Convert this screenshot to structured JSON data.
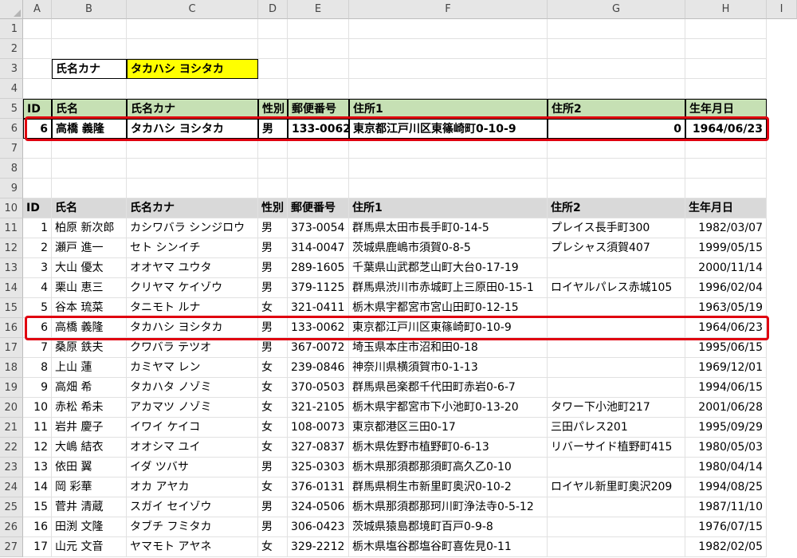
{
  "columns": [
    "A",
    "B",
    "C",
    "D",
    "E",
    "F",
    "G",
    "H",
    "I"
  ],
  "row_numbers": [
    "1",
    "2",
    "3",
    "4",
    "5",
    "6",
    "7",
    "8",
    "9",
    "10",
    "11",
    "12",
    "13",
    "14",
    "15",
    "16",
    "17",
    "18",
    "19",
    "20",
    "21",
    "22",
    "23",
    "24",
    "25",
    "26",
    "27"
  ],
  "search": {
    "label": "氏名カナ",
    "value": "タカハシ ヨシタカ"
  },
  "result_table": {
    "headers": [
      "ID",
      "氏名",
      "氏名カナ",
      "性別",
      "郵便番号",
      "住所1",
      "住所2",
      "生年月日"
    ],
    "row": [
      "6",
      "高橋 義隆",
      "タカハシ ヨシタカ",
      "男",
      "133-0062",
      "東京都江戸川区東篠崎町0-10-9",
      "0",
      "1964/06/23"
    ]
  },
  "data_table": {
    "headers": [
      "ID",
      "氏名",
      "氏名カナ",
      "性別",
      "郵便番号",
      "住所1",
      "住所2",
      "生年月日"
    ],
    "rows": [
      [
        "1",
        "柏原 新次郎",
        "カシワバラ シンジロウ",
        "男",
        "373-0054",
        "群馬県太田市長手町0-14-5",
        "プレイス長手町300",
        "1982/03/07"
      ],
      [
        "2",
        "瀬戸 進一",
        "セト シンイチ",
        "男",
        "314-0047",
        "茨城県鹿嶋市須賀0-8-5",
        "プレシャス須賀407",
        "1999/05/15"
      ],
      [
        "3",
        "大山 優太",
        "オオヤマ ユウタ",
        "男",
        "289-1605",
        "千葉県山武郡芝山町大台0-17-19",
        "",
        "2000/11/14"
      ],
      [
        "4",
        "栗山 恵三",
        "クリヤマ ケイゾウ",
        "男",
        "379-1125",
        "群馬県渋川市赤城町上三原田0-15-1",
        "ロイヤルパレス赤城105",
        "1996/02/04"
      ],
      [
        "5",
        "谷本 琉菜",
        "タニモト ルナ",
        "女",
        "321-0411",
        "栃木県宇都宮市宮山田町0-12-15",
        "",
        "1963/05/19"
      ],
      [
        "6",
        "高橋 義隆",
        "タカハシ ヨシタカ",
        "男",
        "133-0062",
        "東京都江戸川区東篠崎町0-10-9",
        "",
        "1964/06/23"
      ],
      [
        "7",
        "桑原 鉄夫",
        "クワバラ テツオ",
        "男",
        "367-0072",
        "埼玉県本庄市沼和田0-18",
        "",
        "1995/06/15"
      ],
      [
        "8",
        "上山 蓮",
        "カミヤマ レン",
        "女",
        "239-0846",
        "神奈川県横須賀市0-1-13",
        "",
        "1969/12/01"
      ],
      [
        "9",
        "高畑 希",
        "タカハタ ノゾミ",
        "女",
        "370-0503",
        "群馬県邑楽郡千代田町赤岩0-6-7",
        "",
        "1994/06/15"
      ],
      [
        "10",
        "赤松 希未",
        "アカマツ ノゾミ",
        "女",
        "321-2105",
        "栃木県宇都宮市下小池町0-13-20",
        "タワー下小池町217",
        "2001/06/28"
      ],
      [
        "11",
        "岩井 慶子",
        "イワイ ケイコ",
        "女",
        "108-0073",
        "東京都港区三田0-17",
        "三田パレス201",
        "1995/09/29"
      ],
      [
        "12",
        "大嶋 結衣",
        "オオシマ ユイ",
        "女",
        "327-0837",
        "栃木県佐野市植野町0-6-13",
        "リバーサイド植野町415",
        "1980/05/03"
      ],
      [
        "13",
        "依田 翼",
        "イダ ツバサ",
        "男",
        "325-0303",
        "栃木県那須郡那須町高久乙0-10",
        "",
        "1980/04/14"
      ],
      [
        "14",
        "岡 彩華",
        "オカ アヤカ",
        "女",
        "376-0131",
        "群馬県桐生市新里町奥沢0-10-2",
        "ロイヤル新里町奥沢209",
        "1994/08/25"
      ],
      [
        "15",
        "菅井 清蔵",
        "スガイ セイゾウ",
        "男",
        "324-0506",
        "栃木県那須郡那珂川町浄法寺0-5-12",
        "",
        "1987/11/10"
      ],
      [
        "16",
        "田渕 文隆",
        "タブチ フミタカ",
        "男",
        "306-0423",
        "茨城県猿島郡境町百戸0-9-8",
        "",
        "1976/07/15"
      ],
      [
        "17",
        "山元 文音",
        "ヤマモト アヤネ",
        "女",
        "329-2212",
        "栃木県塩谷郡塩谷町喜佐見0-11",
        "",
        "1982/02/05"
      ]
    ]
  }
}
